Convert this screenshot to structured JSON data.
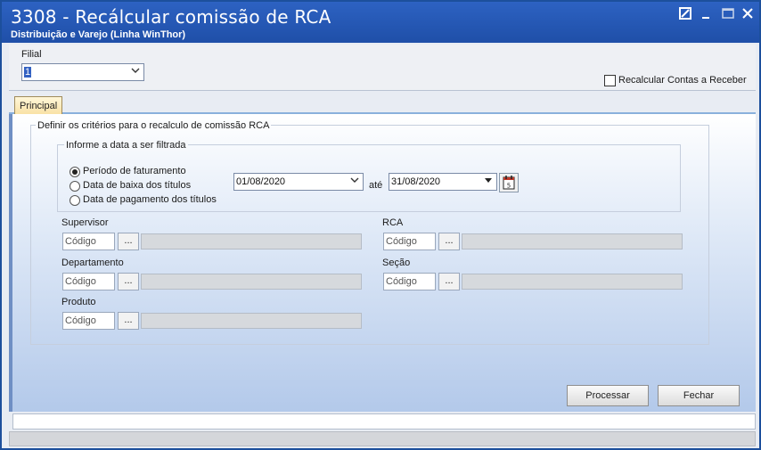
{
  "window": {
    "title": "3308 - Recálcular comissão de RCA",
    "subtitle": "Distribuição e Varejo (Linha WinThor)",
    "controls": [
      "restore-icon",
      "minimize-icon",
      "maximize-icon",
      "close-icon"
    ]
  },
  "filters": {
    "filial_label": "Filial",
    "filial_value": "1",
    "recalcular_label": "Recalcular Contas a Receber",
    "recalcular_checked": false
  },
  "tabs": [
    {
      "label": "Principal",
      "active": true
    }
  ],
  "criteria": {
    "group_title": "Definir os critérios para o recalculo de comissão RCA",
    "date_group_title": "Informe a data a ser filtrada",
    "radio_options": [
      {
        "label": "Período de faturamento",
        "selected": true
      },
      {
        "label": "Data de baixa dos títulos",
        "selected": false
      },
      {
        "label": "Data de pagamento dos títulos",
        "selected": false
      }
    ],
    "date_from": "01/08/2020",
    "ate_label": "até",
    "date_to": "31/08/2020",
    "calendar_icon_number": "5"
  },
  "fields": {
    "supervisor_label": "Supervisor",
    "rca_label": "RCA",
    "departamento_label": "Departamento",
    "secao_label": "Seção",
    "produto_label": "Produto",
    "codigo_placeholder": "Código",
    "ellipsis": "..."
  },
  "actions": {
    "processar_label": "Processar",
    "fechar_label": "Fechar"
  },
  "colors": {
    "titlebar": "#2458b8",
    "tab_active": "#f8dfa0",
    "content_gradient_end": "#b3c9ea"
  }
}
